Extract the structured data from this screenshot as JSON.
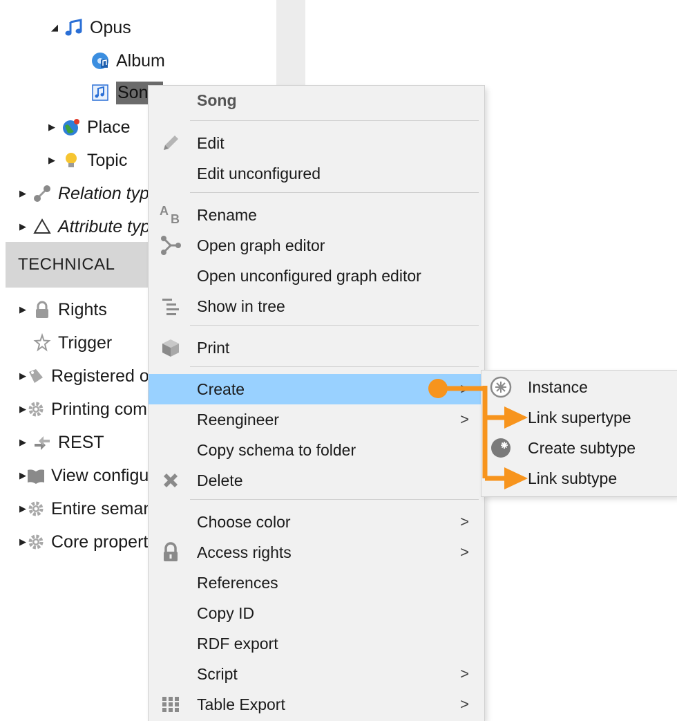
{
  "tree": {
    "items": [
      {
        "label": "Opus",
        "icon": "music-notes-icon",
        "arrow": "expanded"
      },
      {
        "label": "Album",
        "icon": "album-icon"
      },
      {
        "label": "Song",
        "icon": "song-icon"
      },
      {
        "label": "Place",
        "icon": "globe-icon",
        "arrow": "collapsed"
      },
      {
        "label": "Topic",
        "icon": "lightbulb-icon",
        "arrow": "collapsed"
      },
      {
        "label": "Relation types",
        "icon": "relation-icon",
        "arrow": "collapsed"
      },
      {
        "label": "Attribute types",
        "icon": "triangle-icon",
        "arrow": "collapsed"
      },
      {
        "label": "Rights",
        "icon": "lock-icon",
        "arrow": "collapsed"
      },
      {
        "label": "Trigger",
        "icon": "trigger-icon"
      },
      {
        "label": "Registered objects",
        "icon": "registered-icon",
        "arrow": "collapsed"
      },
      {
        "label": "Printing components",
        "icon": "gear-icon",
        "arrow": "collapsed"
      },
      {
        "label": "REST",
        "icon": "rest-icon",
        "arrow": "collapsed"
      },
      {
        "label": "View configuration",
        "icon": "book-icon",
        "arrow": "collapsed"
      },
      {
        "label": "Entire semantic network",
        "icon": "gear-icon",
        "arrow": "collapsed"
      },
      {
        "label": "Core properties",
        "icon": "gear-icon",
        "arrow": "collapsed"
      }
    ],
    "section_header": "TECHNICAL"
  },
  "context_menu": {
    "header": "Song",
    "items": [
      {
        "label": "Edit",
        "icon": "pencil-icon"
      },
      {
        "label": "Edit unconfigured"
      },
      {
        "label": "Rename",
        "icon": "rename-icon"
      },
      {
        "label": "Open graph editor",
        "icon": "graph-icon"
      },
      {
        "label": "Open unconfigured graph editor"
      },
      {
        "label": "Show in tree",
        "icon": "tree-icon"
      },
      {
        "label": "Print",
        "icon": "printer-icon"
      },
      {
        "label": "Create",
        "submenu": true,
        "highlighted": true
      },
      {
        "label": "Reengineer",
        "submenu": true
      },
      {
        "label": "Copy schema to folder"
      },
      {
        "label": "Delete",
        "icon": "delete-icon"
      },
      {
        "label": "Choose color",
        "submenu": true
      },
      {
        "label": "Access rights",
        "icon": "lock-icon",
        "submenu": true
      },
      {
        "label": "References"
      },
      {
        "label": "Copy ID"
      },
      {
        "label": "RDF export"
      },
      {
        "label": "Script",
        "submenu": true
      },
      {
        "label": "Table Export",
        "icon": "grid-icon",
        "submenu": true
      }
    ],
    "submenu_glyph": ">"
  },
  "submenu": {
    "items": [
      {
        "label": "Instance",
        "icon": "instance-icon"
      },
      {
        "label": "Link supertype"
      },
      {
        "label": "Create subtype",
        "icon": "subtype-icon"
      },
      {
        "label": "Link subtype"
      }
    ]
  },
  "colors": {
    "highlight": "#99d1ff",
    "annotation": "#f7941d",
    "menu_bg": "#f1f1f1",
    "section_bg": "#d6d6d6"
  }
}
